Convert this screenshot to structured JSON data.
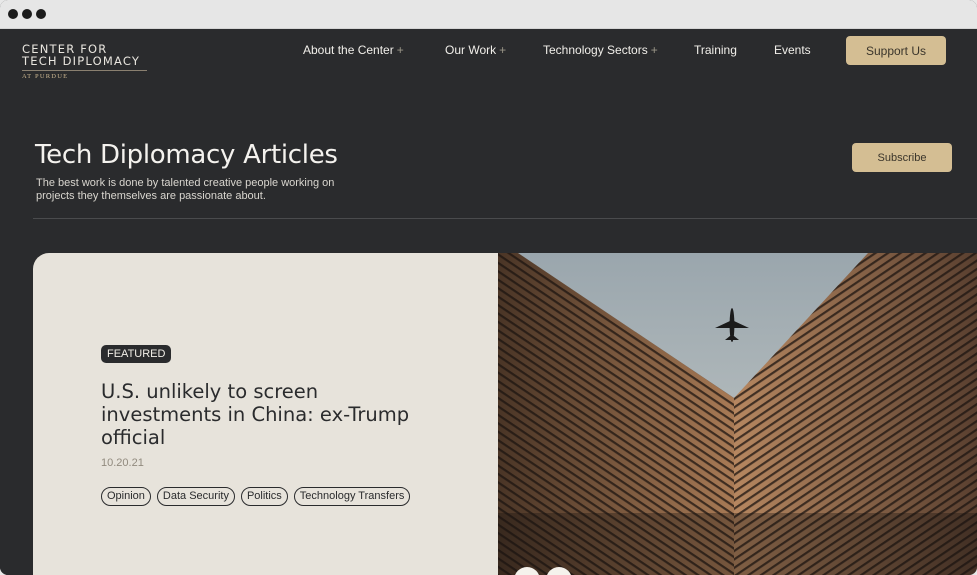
{
  "logo": {
    "line1": "CENTER FOR",
    "line2": "TECH DIPLOMACY",
    "line3": "AT PURDUE"
  },
  "nav": {
    "items": [
      {
        "label": "About the Center",
        "plus": "+"
      },
      {
        "label": "Our Work",
        "plus": "+"
      },
      {
        "label": "Technology Sectors",
        "plus": "+"
      },
      {
        "label": "Training"
      },
      {
        "label": "Events"
      }
    ],
    "support_label": "Support Us"
  },
  "hero": {
    "title": "Tech Diplomacy Articles",
    "subtitle": "The best work is done by talented creative people working on projects they themselves are passionate about.",
    "subscribe_label": "Subscribe"
  },
  "featured": {
    "badge": "FEATURED",
    "headline": "U.S. unlikely to screen investments in China: ex-Trump official",
    "date": "10.20.21",
    "tags": [
      "Opinion",
      "Data Security",
      "Politics",
      "Technology Transfers"
    ]
  },
  "colors": {
    "background": "#2a2b2d",
    "accent": "#d4be93",
    "card": "#e7e3db"
  }
}
